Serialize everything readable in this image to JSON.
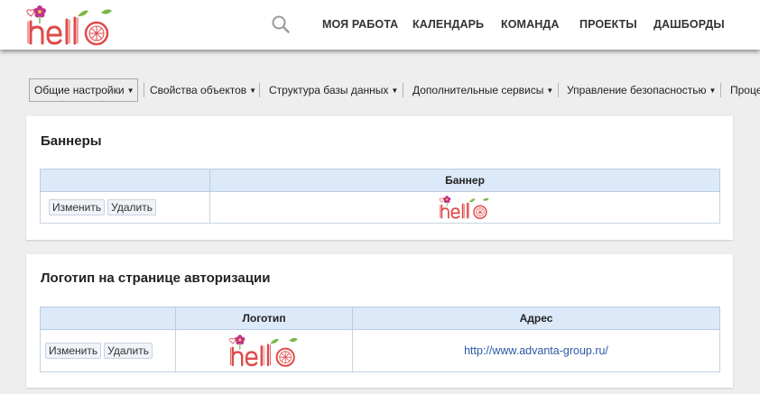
{
  "header": {
    "logo_text": "hello",
    "nav": [
      {
        "label": "МОЯ РАБОТА"
      },
      {
        "label": "КАЛЕНДАРЬ"
      },
      {
        "label": "КОМАНДА"
      },
      {
        "label": "ПРОЕКТЫ"
      },
      {
        "label": "ДАШБОРДЫ"
      }
    ],
    "search_icon": "search-icon"
  },
  "menu": {
    "items": [
      {
        "label": "Общие настройки",
        "active": true
      },
      {
        "label": "Свойства объектов"
      },
      {
        "label": "Структура базы данных"
      },
      {
        "label": "Дополнительные сервисы"
      },
      {
        "label": "Управление безопасностью"
      },
      {
        "label": "Проце"
      }
    ]
  },
  "banners": {
    "title": "Баннеры",
    "columns": [
      "",
      "Баннер"
    ],
    "rows": [
      {
        "edit_label": "Изменить",
        "delete_label": "Удалить",
        "banner_logo": "hello"
      }
    ]
  },
  "auth_logo": {
    "title": "Логотип на странице авторизации",
    "columns": [
      "",
      "Логотип",
      "Адрес"
    ],
    "rows": [
      {
        "edit_label": "Изменить",
        "delete_label": "Удалить",
        "logo": "hello",
        "address": "http://www.advanta-group.ru/"
      }
    ]
  },
  "colors": {
    "logo_red": "#e04a4a",
    "logo_green": "#7ab648",
    "logo_flower": "#c2348c",
    "header_bg": "#ffffff",
    "table_header_bg": "#dce9f8",
    "link": "#2a5aa8"
  }
}
